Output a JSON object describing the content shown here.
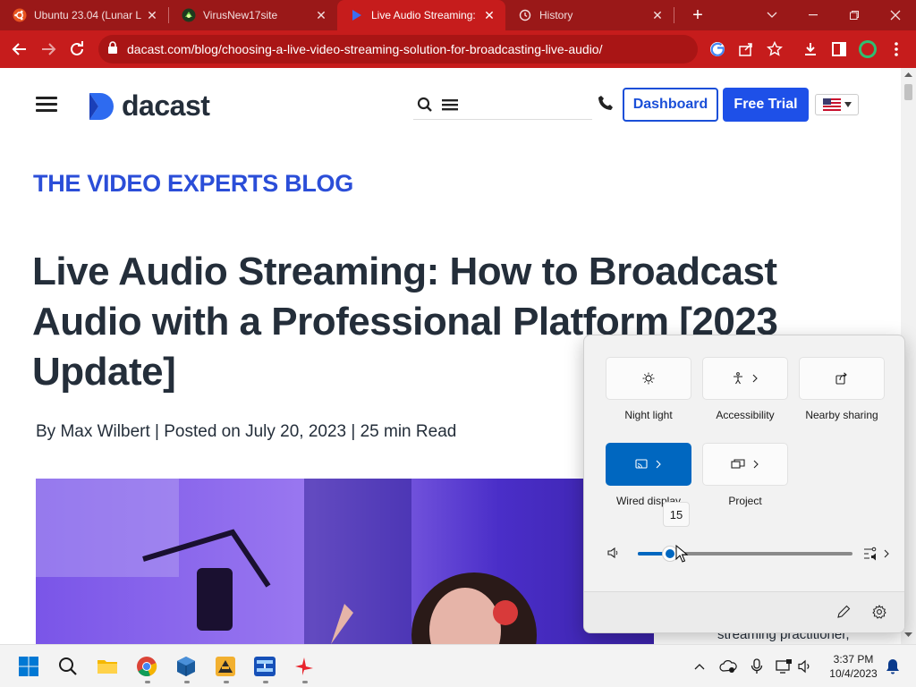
{
  "browser": {
    "tabs": [
      {
        "title": "Ubuntu 23.04 (Lunar L",
        "active": false
      },
      {
        "title": "VirusNew17site",
        "active": false
      },
      {
        "title": "Live Audio Streaming:",
        "active": true
      },
      {
        "title": "History",
        "active": false
      }
    ],
    "new_tab_label": "+",
    "url": "dacast.com/blog/choosing-a-live-video-streaming-solution-for-broadcasting-live-audio/"
  },
  "site": {
    "logo_text": "dacast",
    "dashboard_label": "Dashboard",
    "free_trial_label": "Free Trial",
    "blog_label": "THE VIDEO EXPERTS BLOG",
    "headline": "Live Audio Streaming: How to Broadcast Audio with a Professional Platform [2023 Update]",
    "byline": "By Max Wilbert | Posted on July 20, 2023 | 25 min Read",
    "side_text": "streaming practitioner,"
  },
  "quick_settings": {
    "tiles": [
      {
        "label": "Night light",
        "on": false
      },
      {
        "label": "Accessibility",
        "on": false
      },
      {
        "label": "Nearby sharing",
        "on": false
      },
      {
        "label": "Wired display",
        "on": true
      },
      {
        "label": "Project",
        "on": false
      }
    ],
    "volume": 15,
    "volume_tooltip": "15"
  },
  "taskbar": {
    "time": "3:37 PM",
    "date": "10/4/2023"
  },
  "colors": {
    "browser_frame": "#9a1818",
    "browser_toolbar": "#c61c1c",
    "brand_blue": "#1e50e8",
    "accent": "#0067c0"
  }
}
